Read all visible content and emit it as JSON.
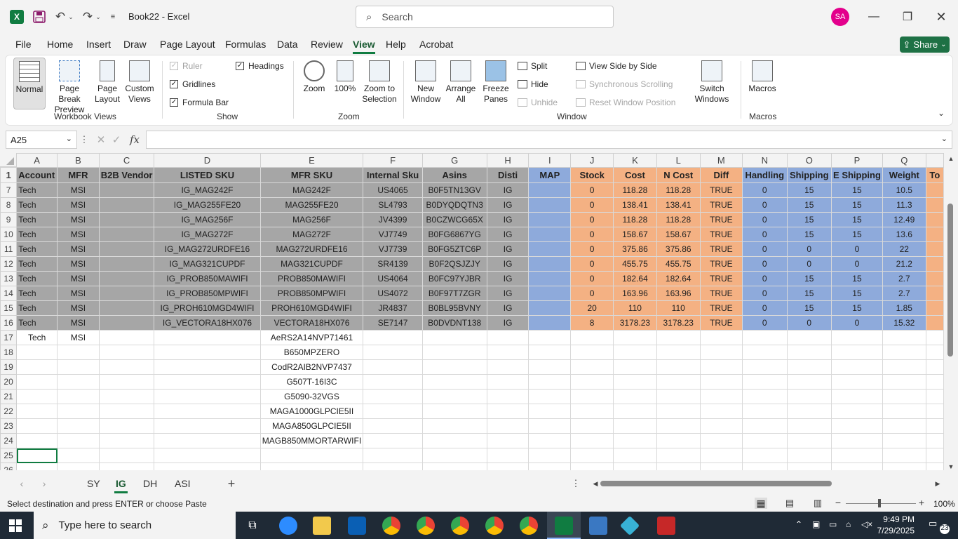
{
  "titlebar": {
    "doc_title": "Book22 - Excel",
    "search_placeholder": "Search",
    "avatar": "SA",
    "logo": "X"
  },
  "menu": [
    "File",
    "Home",
    "Insert",
    "Draw",
    "Page Layout",
    "Formulas",
    "Data",
    "Review",
    "View",
    "Help",
    "Acrobat"
  ],
  "active_menu": "View",
  "share_label": "Share",
  "ribbon": {
    "normal": "Normal",
    "page_break": "Page Break\nPreview",
    "page_layout": "Page\nLayout",
    "custom_views": "Custom\nViews",
    "group_workbook_views": "Workbook Views",
    "ruler": "Ruler",
    "gridlines": "Gridlines",
    "formula_bar": "Formula Bar",
    "headings": "Headings",
    "group_show": "Show",
    "zoom": "Zoom",
    "zoom100": "100%",
    "zoom_selection": "Zoom to\nSelection",
    "group_zoom": "Zoom",
    "new_window": "New\nWindow",
    "arrange_all": "Arrange\nAll",
    "freeze_panes": "Freeze\nPanes",
    "split": "Split",
    "hide": "Hide",
    "unhide": "Unhide",
    "side_by_side": "View Side by Side",
    "sync_scroll": "Synchronous Scrolling",
    "reset_pos": "Reset Window Position",
    "switch_windows": "Switch\nWindows",
    "group_window": "Window",
    "macros": "Macros",
    "group_macros": "Macros"
  },
  "namebox": "A25",
  "fx": "fx",
  "columns": [
    "A",
    "B",
    "C",
    "D",
    "E",
    "F",
    "G",
    "H",
    "I",
    "J",
    "K",
    "L",
    "M",
    "N",
    "O",
    "P",
    "Q",
    ""
  ],
  "header_row": {
    "num": "1",
    "cells": [
      "Account",
      "MFR",
      "B2B Vendor",
      "LISTED SKU",
      "MFR SKU",
      "Internal Sku",
      "Asins",
      "Disti",
      "MAP",
      "Stock",
      "Cost",
      "N Cost",
      "Diff",
      "Handling",
      "Shipping",
      "E Shipping",
      "Weight",
      "To"
    ]
  },
  "rows": [
    {
      "num": "7",
      "cells": [
        "Tech",
        "MSI",
        "",
        "IG_MAG242F",
        "MAG242F",
        "US4065",
        "B0F5TN13GV",
        "IG",
        "",
        "0",
        "118.28",
        "118.28",
        "TRUE",
        "0",
        "15",
        "15",
        "10.5",
        ""
      ]
    },
    {
      "num": "8",
      "cells": [
        "Tech",
        "MSI",
        "",
        "IG_MAG255FE20",
        "MAG255FE20",
        "SL4793",
        "B0DYQDQTN3",
        "IG",
        "",
        "0",
        "138.41",
        "138.41",
        "TRUE",
        "0",
        "15",
        "15",
        "11.3",
        ""
      ]
    },
    {
      "num": "9",
      "cells": [
        "Tech",
        "MSI",
        "",
        "IG_MAG256F",
        "MAG256F",
        "JV4399",
        "B0CZWCG65X",
        "IG",
        "",
        "0",
        "118.28",
        "118.28",
        "TRUE",
        "0",
        "15",
        "15",
        "12.49",
        ""
      ]
    },
    {
      "num": "10",
      "cells": [
        "Tech",
        "MSI",
        "",
        "IG_MAG272F",
        "MAG272F",
        "VJ7749",
        "B0FG6867YG",
        "IG",
        "",
        "0",
        "158.67",
        "158.67",
        "TRUE",
        "0",
        "15",
        "15",
        "13.6",
        ""
      ]
    },
    {
      "num": "11",
      "cells": [
        "Tech",
        "MSI",
        "",
        "IG_MAG272URDFE16",
        "MAG272URDFE16",
        "VJ7739",
        "B0FG5ZTC6P",
        "IG",
        "",
        "0",
        "375.86",
        "375.86",
        "TRUE",
        "0",
        "0",
        "0",
        "22",
        ""
      ]
    },
    {
      "num": "12",
      "cells": [
        "Tech",
        "MSI",
        "",
        "IG_MAG321CUPDF",
        "MAG321CUPDF",
        "SR4139",
        "B0F2QSJZJY",
        "IG",
        "",
        "0",
        "455.75",
        "455.75",
        "TRUE",
        "0",
        "0",
        "0",
        "21.2",
        ""
      ]
    },
    {
      "num": "13",
      "cells": [
        "Tech",
        "MSI",
        "",
        "IG_PROB850MAWIFI",
        "PROB850MAWIFI",
        "US4064",
        "B0FC97YJBR",
        "IG",
        "",
        "0",
        "182.64",
        "182.64",
        "TRUE",
        "0",
        "15",
        "15",
        "2.7",
        ""
      ]
    },
    {
      "num": "14",
      "cells": [
        "Tech",
        "MSI",
        "",
        "IG_PROB850MPWIFI",
        "PROB850MPWIFI",
        "US4072",
        "B0F97T7ZGR",
        "IG",
        "",
        "0",
        "163.96",
        "163.96",
        "TRUE",
        "0",
        "15",
        "15",
        "2.7",
        ""
      ]
    },
    {
      "num": "15",
      "cells": [
        "Tech",
        "MSI",
        "",
        "IG_PROH610MGD4WIFI",
        "PROH610MGD4WIFI",
        "JR4837",
        "B0BL95BVNY",
        "IG",
        "",
        "20",
        "110",
        "110",
        "TRUE",
        "0",
        "15",
        "15",
        "1.85",
        ""
      ]
    },
    {
      "num": "16",
      "cells": [
        "Tech",
        "MSI",
        "",
        "IG_VECTORA18HX076",
        "VECTORA18HX076",
        "SE7147",
        "B0DVDNT138",
        "IG",
        "",
        "8",
        "3178.23",
        "3178.23",
        "TRUE",
        "0",
        "0",
        "0",
        "15.32",
        ""
      ]
    },
    {
      "num": "17",
      "cells": [
        "Tech",
        "MSI",
        "",
        "",
        "AeRS2A14NVP71461",
        "",
        "",
        "",
        "",
        "",
        "",
        "",
        "",
        "",
        "",
        "",
        "",
        ""
      ]
    },
    {
      "num": "18",
      "cells": [
        "",
        "",
        "",
        "",
        "B650MPZERO",
        "",
        "",
        "",
        "",
        "",
        "",
        "",
        "",
        "",
        "",
        "",
        "",
        ""
      ]
    },
    {
      "num": "19",
      "cells": [
        "",
        "",
        "",
        "",
        "CodR2AIB2NVP7437",
        "",
        "",
        "",
        "",
        "",
        "",
        "",
        "",
        "",
        "",
        "",
        "",
        ""
      ]
    },
    {
      "num": "20",
      "cells": [
        "",
        "",
        "",
        "",
        "G507T-16I3C",
        "",
        "",
        "",
        "",
        "",
        "",
        "",
        "",
        "",
        "",
        "",
        "",
        ""
      ]
    },
    {
      "num": "21",
      "cells": [
        "",
        "",
        "",
        "",
        "G5090-32VGS",
        "",
        "",
        "",
        "",
        "",
        "",
        "",
        "",
        "",
        "",
        "",
        "",
        ""
      ]
    },
    {
      "num": "22",
      "cells": [
        "",
        "",
        "",
        "",
        "MAGA1000GLPCIE5II",
        "",
        "",
        "",
        "",
        "",
        "",
        "",
        "",
        "",
        "",
        "",
        "",
        ""
      ]
    },
    {
      "num": "23",
      "cells": [
        "",
        "",
        "",
        "",
        "MAGA850GLPCIE5II",
        "",
        "",
        "",
        "",
        "",
        "",
        "",
        "",
        "",
        "",
        "",
        "",
        ""
      ]
    },
    {
      "num": "24",
      "cells": [
        "",
        "",
        "",
        "",
        "MAGB850MMORTARWIFI",
        "",
        "",
        "",
        "",
        "",
        "",
        "",
        "",
        "",
        "",
        "",
        "",
        ""
      ]
    },
    {
      "num": "25",
      "cells": [
        "",
        "",
        "",
        "",
        "",
        "",
        "",
        "",
        "",
        "",
        "",
        "",
        "",
        "",
        "",
        "",
        "",
        ""
      ]
    },
    {
      "num": "26",
      "cells": [
        "",
        "",
        "",
        "",
        "",
        "",
        "",
        "",
        "",
        "",
        "",
        "",
        "",
        "",
        "",
        "",
        "",
        ""
      ]
    }
  ],
  "sheet_tabs": [
    "SY",
    "IG",
    "DH",
    "ASI"
  ],
  "active_sheet": "IG",
  "status_text": "Select destination and press ENTER or choose Paste",
  "zoom_level": "100%",
  "taskbar": {
    "search_placeholder": "Type here to search",
    "time": "9:49 PM",
    "date": "7/29/2025",
    "notif": "23"
  }
}
